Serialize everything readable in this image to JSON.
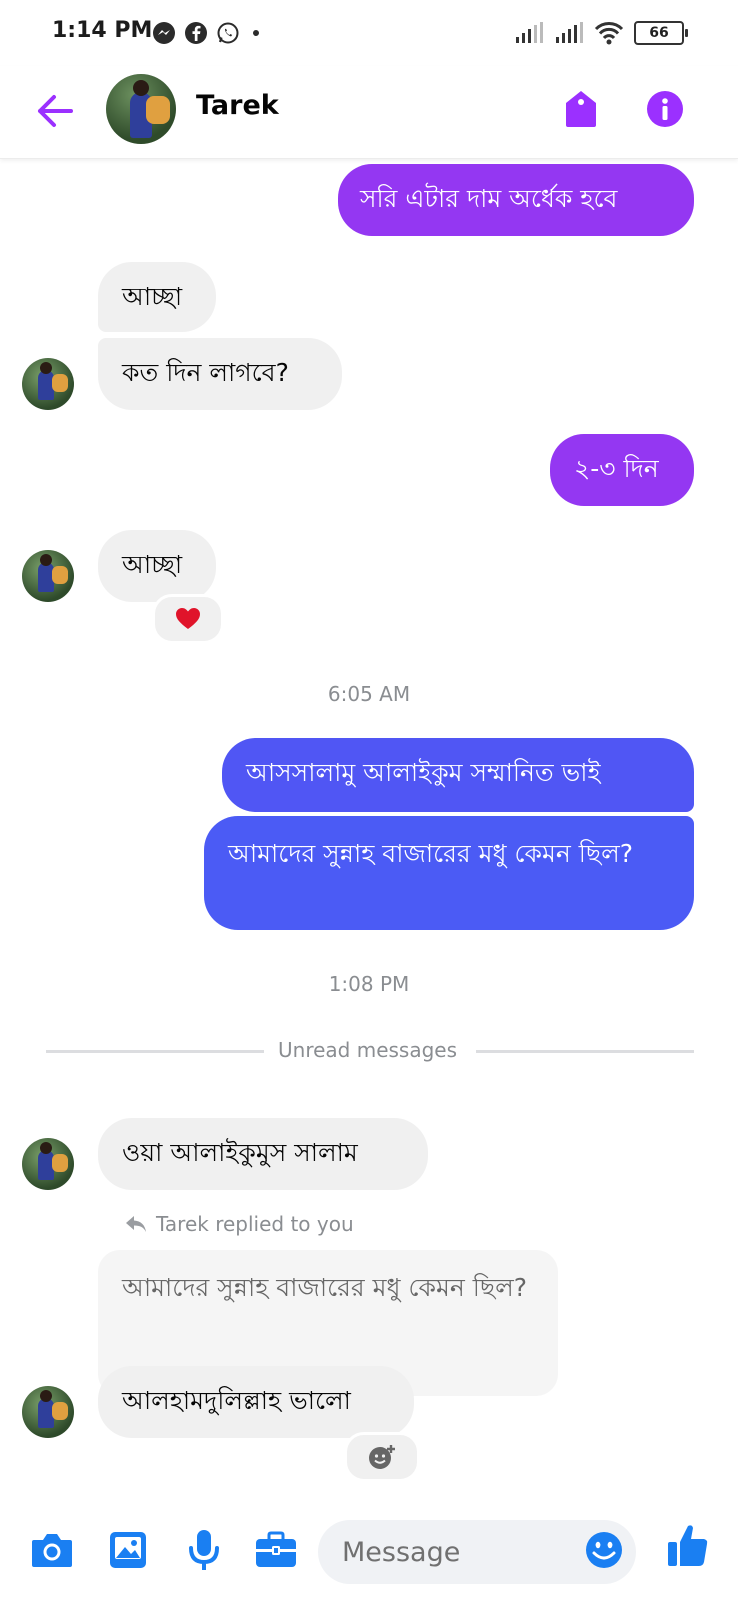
{
  "status_bar": {
    "time": "1:14 PM",
    "left_icons": [
      "messenger-icon",
      "facebook-icon",
      "whatsapp-icon",
      "dot-icon"
    ],
    "right_icons": [
      "signal-icon",
      "signal-icon",
      "wifi-icon"
    ],
    "battery": "66"
  },
  "header": {
    "contact_name": "Tarek",
    "back_icon": "arrow-left-icon",
    "tag_icon": "tag-icon",
    "info_icon": "info-icon"
  },
  "colors": {
    "accent": "#9b30ff",
    "purple_bubble": "#9437f2",
    "blue_bubble": "#4b5bf5",
    "incoming_bubble": "#f0f0f0",
    "composer_icons": "#1a7ff2"
  },
  "messages": {
    "m1": "সরি এটার দাম অর্ধেক হবে",
    "m2": "আচ্ছা",
    "m3": "কত দিন লাগবে?",
    "m4": "২-৩ দিন",
    "m5": "আচ্ছা",
    "m5_reaction": "❤️",
    "time1": "6:05 AM",
    "m6": "আসসালামু আলাইকুম সম্মানিত ভাই",
    "m7": "আমাদের সুন্নাহ বাজারের মধু কেমন ছিল?",
    "time2": "1:08 PM",
    "unread": "Unread messages",
    "m8": "ওয়া আলাইকুমুস সালাম",
    "replied_label": "Tarek replied to you",
    "quoted": "আমাদের সুন্নাহ বাজারের মধু কেমন ছিল?",
    "m9": "আলহামদুলিল্লাহ ভালো"
  },
  "composer": {
    "placeholder": "Message",
    "icons": [
      "camera-icon",
      "image-icon",
      "microphone-icon",
      "briefcase-icon",
      "emoji-icon",
      "thumbs-up-icon"
    ]
  }
}
